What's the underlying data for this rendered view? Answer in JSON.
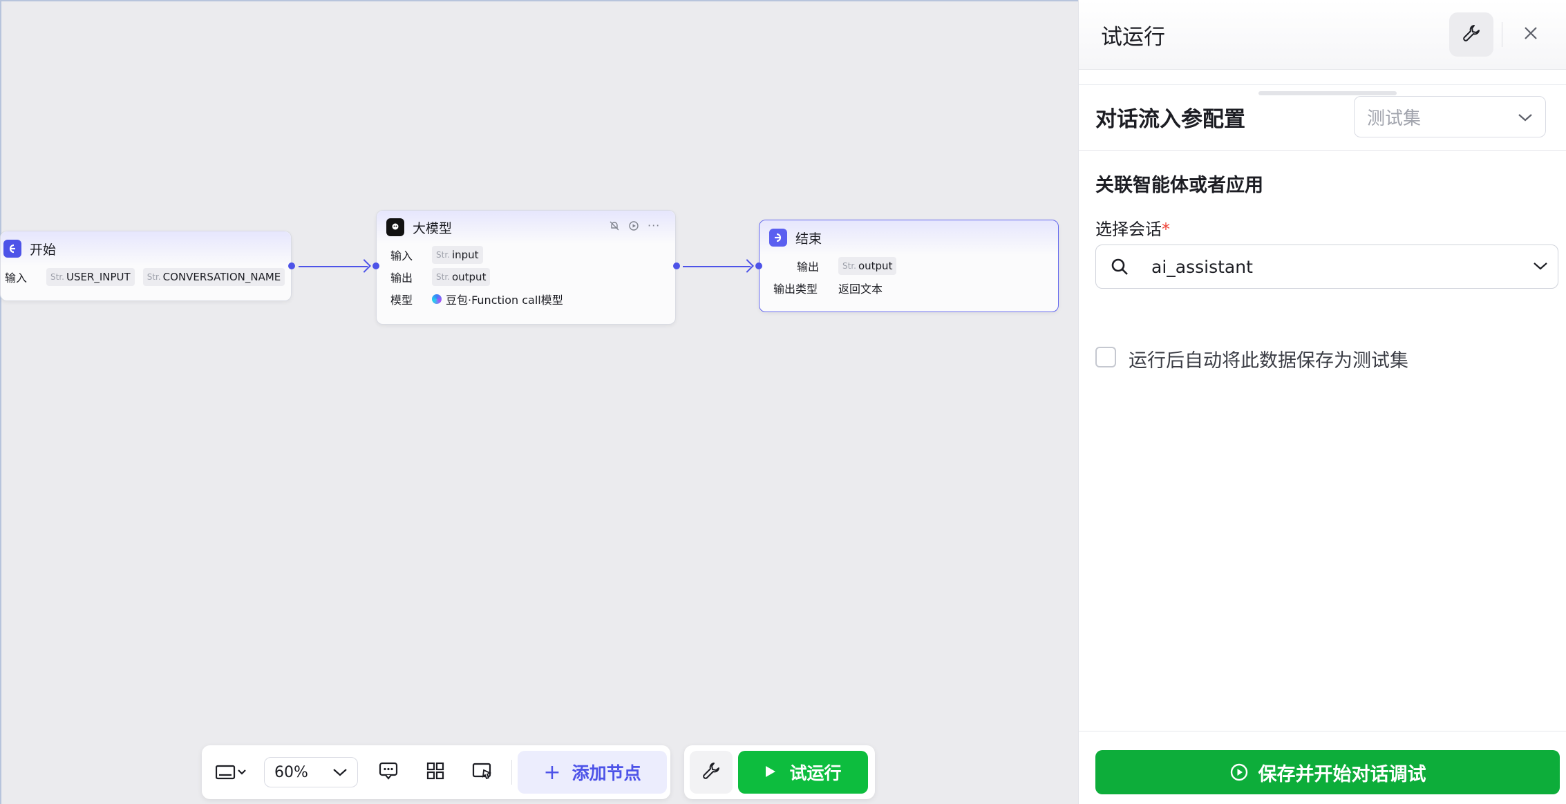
{
  "canvas": {
    "start_node": {
      "title": "开始",
      "input_label": "输入",
      "tags": [
        {
          "type": "Str.",
          "name": "USER_INPUT"
        },
        {
          "type": "Str.",
          "name": "CONVERSATION_NAME"
        }
      ]
    },
    "llm_node": {
      "title": "大模型",
      "input_label": "输入",
      "input_tag": {
        "type": "Str.",
        "name": "input"
      },
      "output_label": "输出",
      "output_tag": {
        "type": "Str.",
        "name": "output"
      },
      "model_label": "模型",
      "model_value": "豆包·Function call模型"
    },
    "end_node": {
      "title": "结束",
      "output_label": "输出",
      "output_tag": {
        "type": "Str.",
        "name": "output"
      },
      "output_type_label": "输出类型",
      "output_type_value": "返回文本"
    }
  },
  "toolbar": {
    "zoom_value": "60%",
    "add_node_label": "添加节点",
    "run_label": "试运行"
  },
  "panel": {
    "title": "试运行",
    "section_title": "对话流入参配置",
    "testset_placeholder": "测试集",
    "link_title": "关联智能体或者应用",
    "select_session_label": "选择会话",
    "required_mark": "*",
    "session_value": "ai_assistant",
    "auto_save_label": "运行后自动将此数据保存为测试集",
    "save_button_label": "保存并开始对话调试"
  },
  "colors": {
    "accent": "#4d53e8",
    "run_green": "#0dbd3e",
    "save_green": "#0dad3a",
    "required_red": "#f04438"
  }
}
